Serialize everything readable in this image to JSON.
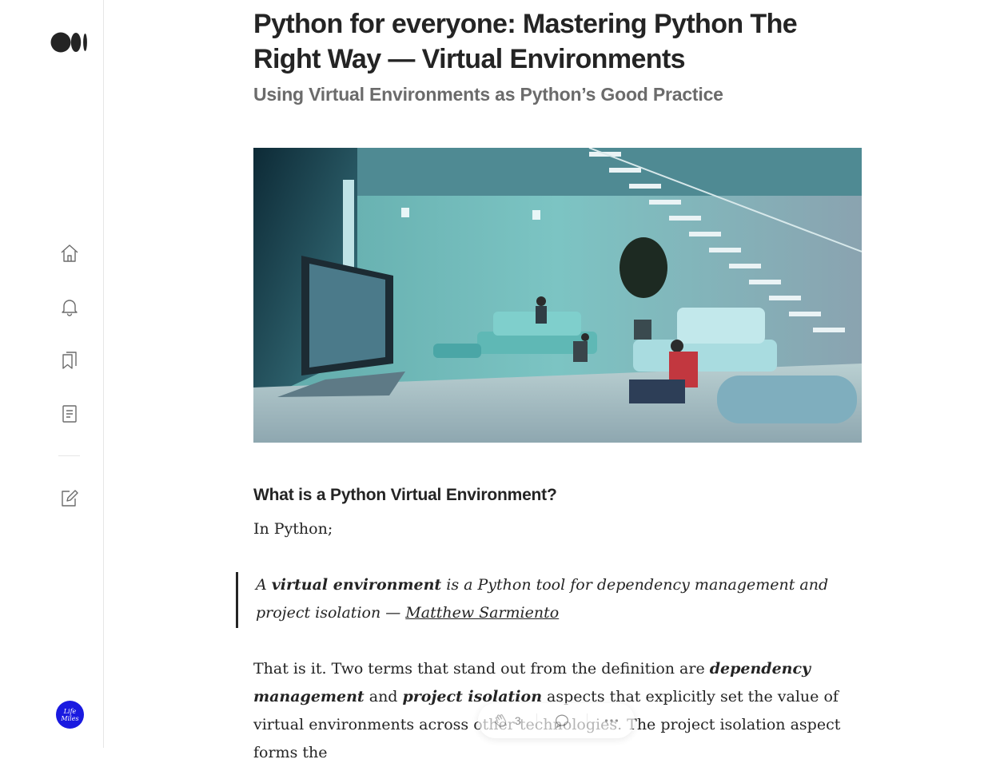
{
  "sidebar": {
    "nav": [
      "home-icon",
      "bell-icon",
      "bookmarks-icon",
      "stories-icon",
      "write-icon"
    ],
    "avatar_text": "Life Miles"
  },
  "article": {
    "title": "Python for everyone: Mastering Python The Right Way — Virtual Environments",
    "subtitle": "Using Virtual Environments as Python’s Good Practice",
    "hero_alt": "Futuristic living room illustration",
    "section_heading": "What is a Python Virtual Environment?",
    "intro": "In Python;",
    "quote": {
      "prefix": "A ",
      "term": "virtual environment",
      "rest": " is a Python tool for dependency management and project isolation — ",
      "author": "Matthew Sarmiento"
    },
    "para2": {
      "a": "That is it. Two terms that stand out from the definition are ",
      "b": "dependency management",
      "c": " and ",
      "d": "project isolation",
      "e": " aspects that explicitly set the value of virtual environments across other technologies. The project isolation aspect forms the"
    }
  },
  "action_bar": {
    "clap_count": "3"
  },
  "colors": {
    "text": "#242424",
    "muted": "#6b6b6b",
    "avatar_bg": "#1a1ae0",
    "border": "#e6e6e6"
  }
}
